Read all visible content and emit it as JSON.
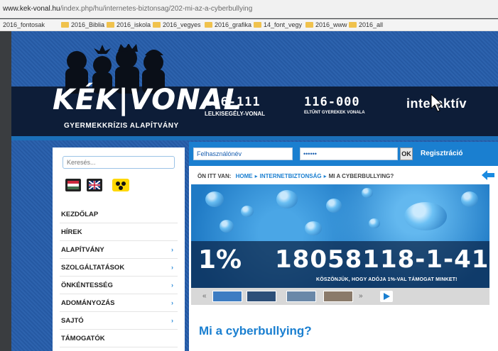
{
  "browser": {
    "url_host": "www.kek-vonal.hu",
    "url_path": "/index.php/hu/internetes-biztonsag/202-mi-az-a-cyberbullying",
    "bookmarks": [
      "2016_fontosak",
      "2016_Biblia",
      "2016_iskola",
      "2016_vegyes",
      "2016_grafika",
      "14_font_vegy",
      "2016_www",
      "2016_all"
    ]
  },
  "header": {
    "logo_text": "KÉK|VONAL",
    "logo_sub": "GYERMEKKRÍZIS ALAPÍTVÁNY",
    "hotline1_number": "116-111",
    "hotline1_label": "LELKISEGÉLY-VONAL",
    "hotline2_number": "116-000",
    "hotline2_label": "ELTŰNT GYEREKEK VONALA",
    "interactive_label": "interaktív"
  },
  "sidebar": {
    "search_placeholder": "Keresés...",
    "menu": [
      {
        "label": "KEZDŐLAP",
        "arrow": ""
      },
      {
        "label": "HÍREK",
        "arrow": ""
      },
      {
        "label": "ALAPÍTVÁNY",
        "arrow": "›"
      },
      {
        "label": "SZOLGÁLTATÁSOK",
        "arrow": "›"
      },
      {
        "label": "ÖNKÉNTESSÉG",
        "arrow": "›"
      },
      {
        "label": "ADOMÁNYOZÁS",
        "arrow": "›"
      },
      {
        "label": "SAJTÓ",
        "arrow": "›"
      },
      {
        "label": "TÁMOGATÓK",
        "arrow": ""
      }
    ]
  },
  "login": {
    "username_value": "Felhasználónév",
    "password_value": "••••••",
    "ok_label": "OK",
    "register_label": "Regisztráció"
  },
  "breadcrumb": {
    "label": "ÖN ITT VAN:",
    "home": "HOME",
    "section": "INTERNETBIZTONSÁG",
    "current": "MI A CYBERBULLYING?"
  },
  "banner": {
    "percent": "1%",
    "tax_number": "18058118-1-41",
    "thanks_text": "KÖSZÖNJÜK, HOGY ADÓJA 1%-VAL TÁMOGAT MINKET!",
    "prev": "«",
    "next": "»"
  },
  "article": {
    "title": "Mi a cyberbullying?"
  },
  "colors": {
    "accent": "#1a7fd0",
    "header_dark": "#0d1d38",
    "page_blue": "#2559a3"
  }
}
